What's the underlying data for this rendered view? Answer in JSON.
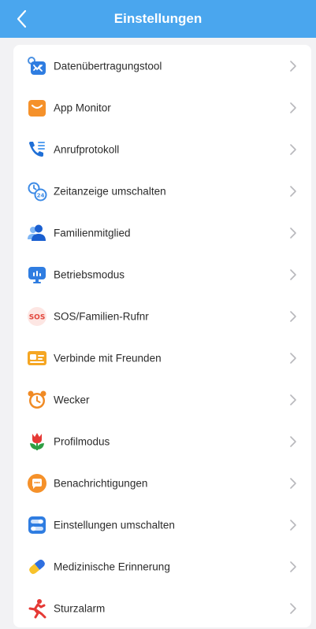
{
  "header": {
    "title": "Einstellungen",
    "background_color": "#4aa6ee",
    "back_icon": "chevron-left-icon"
  },
  "menu": [
    {
      "id": "data-transfer",
      "label": "Datenübertragungstool",
      "icon": "transfer-icon"
    },
    {
      "id": "app-monitor",
      "label": "App Monitor",
      "icon": "bag-icon"
    },
    {
      "id": "call-log",
      "label": "Anrufprotokoll",
      "icon": "phone-list-icon"
    },
    {
      "id": "time-format",
      "label": "Zeitanzeige umschalten",
      "icon": "clock-24-icon"
    },
    {
      "id": "family-member",
      "label": "Familienmitglied",
      "icon": "people-icon"
    },
    {
      "id": "operation-mode",
      "label": "Betriebsmodus",
      "icon": "monitor-icon"
    },
    {
      "id": "sos-number",
      "label": "SOS/Familien-Rufnr",
      "icon": "sos-icon"
    },
    {
      "id": "connect-friends",
      "label": "Verbinde mit Freunden",
      "icon": "id-card-icon"
    },
    {
      "id": "alarm",
      "label": "Wecker",
      "icon": "alarm-clock-icon"
    },
    {
      "id": "profile-mode",
      "label": "Profilmodus",
      "icon": "tulip-icon"
    },
    {
      "id": "notifications",
      "label": "Benachrichtigungen",
      "icon": "chat-bubble-icon"
    },
    {
      "id": "toggle-settings",
      "label": "Einstellungen umschalten",
      "icon": "toggle-switch-icon"
    },
    {
      "id": "medication-reminder",
      "label": "Medizinische Erinnerung",
      "icon": "pill-icon"
    },
    {
      "id": "fall-alarm",
      "label": "Sturzalarm",
      "icon": "falling-person-icon"
    }
  ]
}
